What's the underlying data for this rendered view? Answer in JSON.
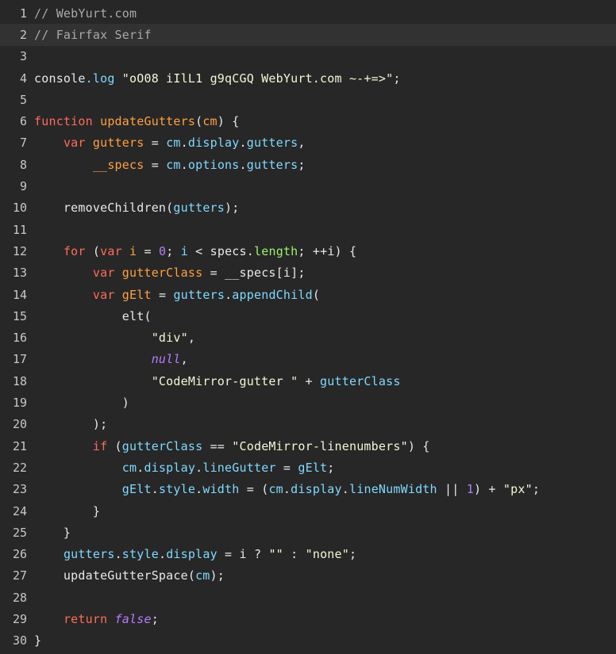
{
  "colors": {
    "background": "#272727",
    "active_line": "#323232",
    "gutter_text": "#c8c8c8",
    "comment": "#a9a9a9",
    "keyword": "#ff6b5b",
    "variable": "#ffa040",
    "property": "#7fd9ff",
    "string": "#f5f5d8",
    "number": "#b87cff",
    "atom": "#b87cff",
    "builtin": "#9fef6f",
    "plain": "#e8e8e8"
  },
  "editor": {
    "active_line": 2,
    "lines": [
      {
        "n": "1",
        "tokens": [
          {
            "t": "comment",
            "v": "// WebYurt.com"
          }
        ]
      },
      {
        "n": "2",
        "tokens": [
          {
            "t": "comment",
            "v": "// Fairfax Serif"
          }
        ]
      },
      {
        "n": "3",
        "tokens": []
      },
      {
        "n": "4",
        "tokens": [
          {
            "t": "plain",
            "v": "console"
          },
          {
            "t": "prop",
            "v": ".log"
          },
          {
            "t": "plain",
            "v": " "
          },
          {
            "t": "string",
            "v": "\"oO08 iIlL1 g9qCGQ WebYurt.com ~-+=>\""
          },
          {
            "t": "plain",
            "v": ";"
          }
        ]
      },
      {
        "n": "5",
        "tokens": []
      },
      {
        "n": "6",
        "tokens": [
          {
            "t": "keyword",
            "v": "function"
          },
          {
            "t": "plain",
            "v": " "
          },
          {
            "t": "def",
            "v": "updateGutters"
          },
          {
            "t": "plain",
            "v": "("
          },
          {
            "t": "var",
            "v": "cm"
          },
          {
            "t": "plain",
            "v": ") {"
          }
        ]
      },
      {
        "n": "7",
        "tokens": [
          {
            "t": "plain",
            "v": "    "
          },
          {
            "t": "keyword",
            "v": "var"
          },
          {
            "t": "plain",
            "v": " "
          },
          {
            "t": "var",
            "v": "gutters"
          },
          {
            "t": "plain",
            "v": " = "
          },
          {
            "t": "prop",
            "v": "cm"
          },
          {
            "t": "plain",
            "v": "."
          },
          {
            "t": "prop",
            "v": "display"
          },
          {
            "t": "plain",
            "v": "."
          },
          {
            "t": "prop",
            "v": "gutters"
          },
          {
            "t": "plain",
            "v": ","
          }
        ]
      },
      {
        "n": "8",
        "tokens": [
          {
            "t": "plain",
            "v": "        "
          },
          {
            "t": "var",
            "v": "__specs"
          },
          {
            "t": "plain",
            "v": " = "
          },
          {
            "t": "prop",
            "v": "cm"
          },
          {
            "t": "plain",
            "v": "."
          },
          {
            "t": "prop",
            "v": "options"
          },
          {
            "t": "plain",
            "v": "."
          },
          {
            "t": "prop",
            "v": "gutters"
          },
          {
            "t": "plain",
            "v": ";"
          }
        ]
      },
      {
        "n": "9",
        "tokens": []
      },
      {
        "n": "10",
        "tokens": [
          {
            "t": "plain",
            "v": "    removeChildren("
          },
          {
            "t": "prop",
            "v": "gutters"
          },
          {
            "t": "plain",
            "v": ");"
          }
        ]
      },
      {
        "n": "11",
        "tokens": []
      },
      {
        "n": "12",
        "tokens": [
          {
            "t": "plain",
            "v": "    "
          },
          {
            "t": "keyword",
            "v": "for"
          },
          {
            "t": "plain",
            "v": " ("
          },
          {
            "t": "keyword",
            "v": "var"
          },
          {
            "t": "plain",
            "v": " "
          },
          {
            "t": "var",
            "v": "i"
          },
          {
            "t": "plain",
            "v": " = "
          },
          {
            "t": "number",
            "v": "0"
          },
          {
            "t": "plain",
            "v": "; "
          },
          {
            "t": "prop",
            "v": "i"
          },
          {
            "t": "plain",
            "v": " < specs."
          },
          {
            "t": "builtin",
            "v": "length"
          },
          {
            "t": "plain",
            "v": "; ++i) {"
          }
        ]
      },
      {
        "n": "13",
        "tokens": [
          {
            "t": "plain",
            "v": "        "
          },
          {
            "t": "keyword",
            "v": "var"
          },
          {
            "t": "plain",
            "v": " "
          },
          {
            "t": "var",
            "v": "gutterClass"
          },
          {
            "t": "plain",
            "v": " = __specs[i];"
          }
        ]
      },
      {
        "n": "14",
        "tokens": [
          {
            "t": "plain",
            "v": "        "
          },
          {
            "t": "keyword",
            "v": "var"
          },
          {
            "t": "plain",
            "v": " "
          },
          {
            "t": "var",
            "v": "gElt"
          },
          {
            "t": "plain",
            "v": " = "
          },
          {
            "t": "prop",
            "v": "gutters"
          },
          {
            "t": "plain",
            "v": "."
          },
          {
            "t": "prop",
            "v": "appendChild"
          },
          {
            "t": "plain",
            "v": "("
          }
        ]
      },
      {
        "n": "15",
        "tokens": [
          {
            "t": "plain",
            "v": "            elt("
          }
        ]
      },
      {
        "n": "16",
        "tokens": [
          {
            "t": "plain",
            "v": "                "
          },
          {
            "t": "string",
            "v": "\"div\""
          },
          {
            "t": "plain",
            "v": ","
          }
        ]
      },
      {
        "n": "17",
        "tokens": [
          {
            "t": "plain",
            "v": "                "
          },
          {
            "t": "atom",
            "v": "null"
          },
          {
            "t": "plain",
            "v": ","
          }
        ]
      },
      {
        "n": "18",
        "tokens": [
          {
            "t": "plain",
            "v": "                "
          },
          {
            "t": "string",
            "v": "\"CodeMirror-gutter \""
          },
          {
            "t": "plain",
            "v": " + "
          },
          {
            "t": "prop",
            "v": "gutterClass"
          }
        ]
      },
      {
        "n": "19",
        "tokens": [
          {
            "t": "plain",
            "v": "            )"
          }
        ]
      },
      {
        "n": "20",
        "tokens": [
          {
            "t": "plain",
            "v": "        );"
          }
        ]
      },
      {
        "n": "21",
        "tokens": [
          {
            "t": "plain",
            "v": "        "
          },
          {
            "t": "keyword",
            "v": "if"
          },
          {
            "t": "plain",
            "v": " ("
          },
          {
            "t": "prop",
            "v": "gutterClass"
          },
          {
            "t": "plain",
            "v": " == "
          },
          {
            "t": "string",
            "v": "\"CodeMirror-linenumbers\""
          },
          {
            "t": "plain",
            "v": ") {"
          }
        ]
      },
      {
        "n": "22",
        "tokens": [
          {
            "t": "plain",
            "v": "            "
          },
          {
            "t": "prop",
            "v": "cm"
          },
          {
            "t": "plain",
            "v": "."
          },
          {
            "t": "prop",
            "v": "display"
          },
          {
            "t": "plain",
            "v": "."
          },
          {
            "t": "prop",
            "v": "lineGutter"
          },
          {
            "t": "plain",
            "v": " = "
          },
          {
            "t": "prop",
            "v": "gElt"
          },
          {
            "t": "plain",
            "v": ";"
          }
        ]
      },
      {
        "n": "23",
        "tokens": [
          {
            "t": "plain",
            "v": "            "
          },
          {
            "t": "prop",
            "v": "gElt"
          },
          {
            "t": "plain",
            "v": "."
          },
          {
            "t": "prop",
            "v": "style"
          },
          {
            "t": "plain",
            "v": "."
          },
          {
            "t": "prop",
            "v": "width"
          },
          {
            "t": "plain",
            "v": " = ("
          },
          {
            "t": "prop",
            "v": "cm"
          },
          {
            "t": "plain",
            "v": "."
          },
          {
            "t": "prop",
            "v": "display"
          },
          {
            "t": "plain",
            "v": "."
          },
          {
            "t": "prop",
            "v": "lineNumWidth"
          },
          {
            "t": "plain",
            "v": " || "
          },
          {
            "t": "number",
            "v": "1"
          },
          {
            "t": "plain",
            "v": ") + "
          },
          {
            "t": "string",
            "v": "\"px\""
          },
          {
            "t": "plain",
            "v": ";"
          }
        ]
      },
      {
        "n": "24",
        "tokens": [
          {
            "t": "plain",
            "v": "        }"
          }
        ]
      },
      {
        "n": "25",
        "tokens": [
          {
            "t": "plain",
            "v": "    }"
          }
        ]
      },
      {
        "n": "26",
        "tokens": [
          {
            "t": "plain",
            "v": "    "
          },
          {
            "t": "prop",
            "v": "gutters"
          },
          {
            "t": "plain",
            "v": "."
          },
          {
            "t": "prop",
            "v": "style"
          },
          {
            "t": "plain",
            "v": "."
          },
          {
            "t": "prop",
            "v": "display"
          },
          {
            "t": "plain",
            "v": " = i ? "
          },
          {
            "t": "string",
            "v": "\"\""
          },
          {
            "t": "plain",
            "v": " : "
          },
          {
            "t": "string",
            "v": "\"none\""
          },
          {
            "t": "plain",
            "v": ";"
          }
        ]
      },
      {
        "n": "27",
        "tokens": [
          {
            "t": "plain",
            "v": "    updateGutterSpace("
          },
          {
            "t": "prop",
            "v": "cm"
          },
          {
            "t": "plain",
            "v": ");"
          }
        ]
      },
      {
        "n": "28",
        "tokens": []
      },
      {
        "n": "29",
        "tokens": [
          {
            "t": "plain",
            "v": "    "
          },
          {
            "t": "keyword",
            "v": "return"
          },
          {
            "t": "plain",
            "v": " "
          },
          {
            "t": "atom",
            "v": "false"
          },
          {
            "t": "plain",
            "v": ";"
          }
        ]
      },
      {
        "n": "30",
        "tokens": [
          {
            "t": "plain",
            "v": "}"
          }
        ]
      }
    ]
  }
}
